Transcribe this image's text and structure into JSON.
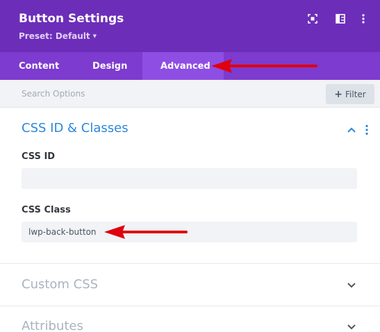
{
  "header": {
    "title": "Button Settings",
    "preset_label": "Preset: Default",
    "icons": [
      "expand-icon",
      "split-view-icon",
      "more-vertical-icon"
    ]
  },
  "tabs": [
    {
      "label": "Content",
      "active": false
    },
    {
      "label": "Design",
      "active": false
    },
    {
      "label": "Advanced",
      "active": true
    }
  ],
  "search": {
    "placeholder": "Search Options",
    "filter_label": "Filter"
  },
  "sections": {
    "css_id_classes": {
      "title": "CSS ID & Classes",
      "expanded": true,
      "css_id": {
        "label": "CSS ID",
        "value": ""
      },
      "css_class": {
        "label": "CSS Class",
        "value": "lwp-back-button"
      }
    },
    "custom_css": {
      "title": "Custom CSS",
      "expanded": false
    },
    "attributes": {
      "title": "Attributes",
      "expanded": false
    }
  },
  "colors": {
    "header_bg": "#6c2eb9",
    "tabs_bg": "#7d3bcf",
    "active_tab_bg": "#8f4ee3",
    "section_title_active": "#2b87da",
    "annotation_arrow": "#e0000f"
  }
}
